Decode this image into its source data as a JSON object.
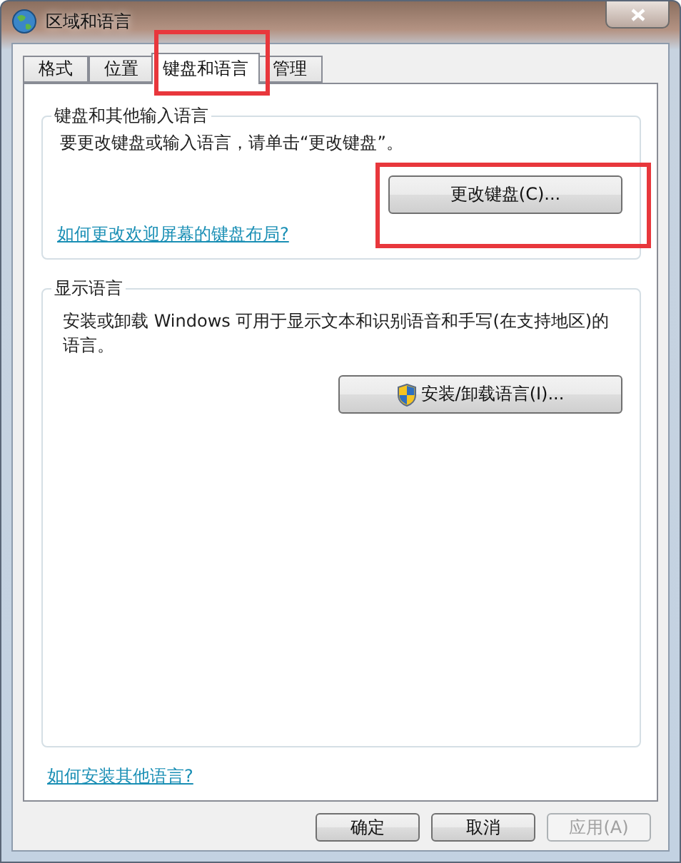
{
  "window": {
    "title": "区域和语言"
  },
  "tabs": [
    {
      "label": "格式",
      "selected": false
    },
    {
      "label": "位置",
      "selected": false
    },
    {
      "label": "键盘和语言",
      "selected": true
    },
    {
      "label": "管理",
      "selected": false
    }
  ],
  "keyboard_group": {
    "legend": "键盘和其他输入语言",
    "text": "要更改键盘或输入语言，请单击“更改键盘”。",
    "button": "更改键盘(C)...",
    "link": "如何更改欢迎屏幕的键盘布局?"
  },
  "display_group": {
    "legend": "显示语言",
    "text": "安装或卸载 Windows 可用于显示文本和识别语音和手写(在支持地区)的语言。",
    "button": "安装/卸载语言(I)..."
  },
  "link": "如何安装其他语言?",
  "buttons": [
    {
      "label": "确定",
      "disabled": false
    },
    {
      "label": "取消",
      "disabled": false
    },
    {
      "label": "应用(A)",
      "disabled": true
    }
  ]
}
